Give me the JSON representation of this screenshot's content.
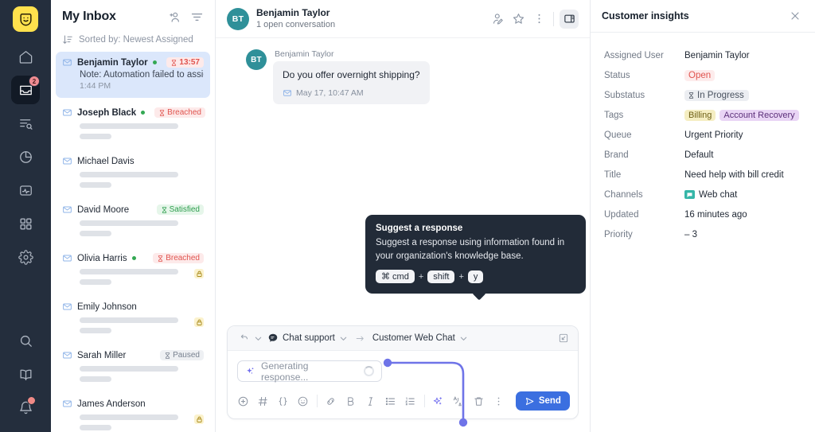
{
  "rail": {
    "logo": "smiley-logo",
    "items": [
      {
        "name": "home",
        "icon": "home-icon",
        "active": false
      },
      {
        "name": "inbox",
        "icon": "inbox-icon",
        "active": true,
        "badge": "2"
      },
      {
        "name": "search-list",
        "icon": "list-search-icon",
        "active": false
      },
      {
        "name": "reports",
        "icon": "pie-chart-icon",
        "active": false
      },
      {
        "name": "activity",
        "icon": "activity-icon",
        "active": false
      },
      {
        "name": "apps",
        "icon": "grid-apps-icon",
        "active": false
      },
      {
        "name": "settings",
        "icon": "gear-icon",
        "active": false
      }
    ],
    "bottom_items": [
      {
        "name": "search",
        "icon": "search-icon"
      },
      {
        "name": "knowledge",
        "icon": "book-icon"
      },
      {
        "name": "notifications",
        "icon": "bell-icon",
        "dot": true
      }
    ]
  },
  "inbox": {
    "title": "My Inbox",
    "add_user_icon": "add-person-icon",
    "filter_icon": "filter-icon",
    "sort_icon": "sort-icon",
    "sort_label": "Sorted by: Newest Assigned",
    "conversations": [
      {
        "name": "Benjamin Taylor",
        "online": true,
        "bold": true,
        "status": "13:57",
        "status_type": "timer",
        "snippet": "Note: Automation failed to assign...",
        "time": "1:44 PM",
        "selected": true,
        "lock": false
      },
      {
        "name": "Joseph Black",
        "online": true,
        "bold": true,
        "status": "Breached",
        "status_type": "breached",
        "snippet": "",
        "time": "",
        "selected": false,
        "lock": false
      },
      {
        "name": "Michael Davis",
        "online": false,
        "bold": false,
        "status": "",
        "status_type": "",
        "snippet": "",
        "time": "",
        "selected": false,
        "lock": false
      },
      {
        "name": "David Moore",
        "online": false,
        "bold": false,
        "status": "Satisfied",
        "status_type": "satisfied",
        "snippet": "",
        "time": "",
        "selected": false,
        "lock": false
      },
      {
        "name": "Olivia Harris",
        "online": true,
        "bold": false,
        "status": "Breached",
        "status_type": "breached",
        "snippet": "",
        "time": "",
        "selected": false,
        "lock": true
      },
      {
        "name": "Emily Johnson",
        "online": false,
        "bold": false,
        "status": "",
        "status_type": "",
        "snippet": "",
        "time": "",
        "selected": false,
        "lock": true
      },
      {
        "name": "Sarah Miller",
        "online": false,
        "bold": false,
        "status": "Paused",
        "status_type": "paused",
        "snippet": "",
        "time": "",
        "selected": false,
        "lock": false
      },
      {
        "name": "James Anderson",
        "online": false,
        "bold": false,
        "status": "",
        "status_type": "",
        "snippet": "",
        "time": "",
        "selected": false,
        "lock": true
      }
    ]
  },
  "conversation": {
    "avatar_initials": "BT",
    "contact_name": "Benjamin Taylor",
    "subtitle": "1 open conversation",
    "actions": [
      {
        "name": "edit-contact",
        "icon": "person-edit-icon"
      },
      {
        "name": "favorite",
        "icon": "star-icon"
      },
      {
        "name": "more-options",
        "icon": "more-vertical-icon"
      },
      {
        "name": "toggle-panel",
        "icon": "side-panel-icon",
        "active": true
      }
    ],
    "messages": [
      {
        "author": "Benjamin Taylor",
        "avatar_initials": "BT",
        "text": "Do you offer overnight shipping?",
        "channel_icon": "mail-icon",
        "timestamp": "May 17, 10:47 AM"
      }
    ]
  },
  "composer": {
    "undo_icon": "undo-icon",
    "channel_icon": "chat-bubble-icon",
    "channel_label": "Chat support",
    "arrow_icon": "arrow-right-icon",
    "target_label": "Customer Web Chat",
    "expand_icon": "expand-icon",
    "generating_text": "Generating response...",
    "generating_icon": "sparkle-icon",
    "toolbar": [
      {
        "name": "insert-attachment",
        "icon": "plus-circle-icon",
        "glyph": "plus-circle"
      },
      {
        "name": "insert-macro",
        "icon": "hash-icon",
        "glyph": "hash"
      },
      {
        "name": "insert-variable",
        "icon": "braces-icon",
        "glyph": "braces"
      },
      {
        "name": "insert-emoji",
        "icon": "emoji-icon",
        "glyph": "emoji"
      },
      {
        "name": "insert-link",
        "icon": "link-icon",
        "glyph": "link"
      },
      {
        "name": "bold",
        "icon": "bold-icon",
        "glyph": "bold"
      },
      {
        "name": "italic",
        "icon": "italic-icon",
        "glyph": "italic"
      },
      {
        "name": "bullet-list",
        "icon": "bullet-list-icon",
        "glyph": "ul"
      },
      {
        "name": "numbered-list",
        "icon": "numbered-list-icon",
        "glyph": "ol"
      },
      {
        "name": "suggest-response",
        "icon": "sparkle-icon",
        "glyph": "sparkle"
      },
      {
        "name": "translate",
        "icon": "translate-icon",
        "glyph": "translate"
      }
    ],
    "delete_icon": "trash-icon",
    "more_icon": "more-vertical-icon",
    "send_icon": "send-icon",
    "send_label": "Send"
  },
  "tooltip": {
    "title": "Suggest a response",
    "body": "Suggest a response using information found in your organization's knowledge base.",
    "keys": [
      "⌘ cmd",
      "shift",
      "y"
    ],
    "separator": "+"
  },
  "insights": {
    "title": "Customer insights",
    "close_icon": "close-icon",
    "fields": [
      {
        "label": "Assigned User",
        "value": "Benjamin Taylor",
        "type": "text"
      },
      {
        "label": "Status",
        "value": "Open",
        "type": "open"
      },
      {
        "label": "Substatus",
        "value": "In Progress",
        "type": "progress"
      },
      {
        "label": "Tags",
        "value": "",
        "type": "tags",
        "tags": [
          "Billing",
          "Account Recovery"
        ]
      },
      {
        "label": "Queue",
        "value": "Urgent Priority",
        "type": "text"
      },
      {
        "label": "Brand",
        "value": "Default",
        "type": "text"
      },
      {
        "label": "Title",
        "value": "Need help with bill credit",
        "type": "text"
      },
      {
        "label": "Channels",
        "value": "Web chat",
        "type": "channel"
      },
      {
        "label": "Updated",
        "value": "16 minutes ago",
        "type": "text"
      },
      {
        "label": "Priority",
        "value": "– 3",
        "type": "text"
      }
    ]
  },
  "colors": {
    "rail_bg": "#242e3d",
    "logo_yellow": "#ffe14d",
    "accent_blue": "#3b6fe0",
    "selected_blue": "#dbe7fb",
    "avatar_teal": "#2f9099",
    "breached_red": "#e0544f",
    "satisfied_green": "#2f9e4f",
    "ai_purple": "#7d7af0",
    "tooltip_bg": "#222b38"
  }
}
